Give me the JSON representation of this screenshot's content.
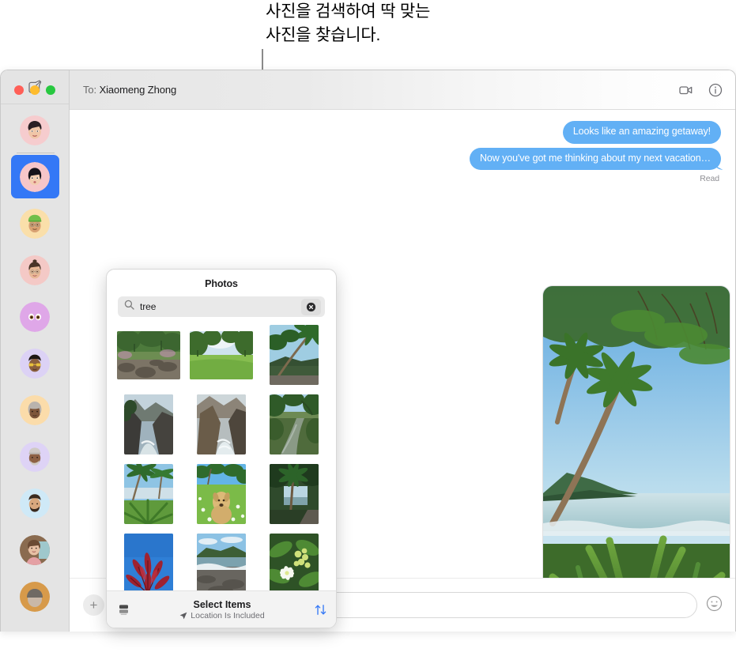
{
  "callout": {
    "text": "사진을 검색하여 딱 맞는\n사진을 찾습니다."
  },
  "window": {
    "traffic_lights": [
      "close",
      "minimize",
      "zoom"
    ],
    "toolbar": {
      "to_label": "To:",
      "recipient": "Xiaomeng Zhong",
      "video_icon": "video-camera-icon",
      "info_icon": "info-circle-icon"
    }
  },
  "sidebar": {
    "compose_icon": "compose-icon",
    "items": [
      {
        "name": "chat-1",
        "avatar": "memoji-woman-dark-hair",
        "bg": "#f6ccce",
        "selected": false
      },
      {
        "name": "chat-2",
        "avatar": "memoji-woman-black-bob",
        "bg": "#f7c6c9",
        "selected": true
      },
      {
        "name": "chat-3",
        "avatar": "memoji-green-beanie-glasses",
        "bg": "#fadfaa",
        "selected": false
      },
      {
        "name": "chat-4",
        "avatar": "memoji-woman-bun-glasses",
        "bg": "#f4c9c6",
        "selected": false
      },
      {
        "name": "chat-5",
        "avatar": "memoji-eyes-only",
        "bg": "#dfa7e8",
        "selected": false
      },
      {
        "name": "chat-6",
        "avatar": "memoji-yellow-sunglasses",
        "bg": "#dcd2f5",
        "selected": false
      },
      {
        "name": "chat-7",
        "avatar": "memoji-gray-hair-woman",
        "bg": "#fbdcaa",
        "selected": false
      },
      {
        "name": "chat-8",
        "avatar": "memoji-gray-beard-headwrap",
        "bg": "#ded3f6",
        "selected": false
      },
      {
        "name": "chat-9",
        "avatar": "memoji-beard-man",
        "bg": "#cfe9f7",
        "selected": false
      },
      {
        "name": "chat-10",
        "avatar": "photo-woman-portrait",
        "bg": "#8a6b4f",
        "selected": false
      },
      {
        "name": "chat-11",
        "avatar": "photo-person-partial",
        "bg": "#d79a4a",
        "selected": false
      }
    ]
  },
  "conversation": {
    "messages": [
      {
        "text": "Looks like an amazing getaway!",
        "side": "outgoing",
        "tail": false
      },
      {
        "text": "Now you've got me thinking about my next vacation…",
        "side": "outgoing",
        "tail": true
      }
    ],
    "status": "Read",
    "attachment": {
      "name": "tropical-beach-palms-photo",
      "alt": "Tropical coastline with palm trees and green foliage"
    },
    "bubble_color": "#62b0f5"
  },
  "composer": {
    "add_icon": "plus-icon",
    "input_placeholder": "",
    "input_value": "",
    "emoji_icon": "smiley-icon"
  },
  "photos_popover": {
    "title": "Photos",
    "search": {
      "icon": "search-icon",
      "value": "tree",
      "placeholder": "Search",
      "clear_icon": "clear-circle-icon"
    },
    "thumbnails": [
      {
        "name": "photo-forest-rocks",
        "alt": "Forest with rocky stream",
        "orient": "landscape"
      },
      {
        "name": "photo-green-meadow",
        "alt": "Green meadow with trees",
        "orient": "landscape"
      },
      {
        "name": "photo-palm-river",
        "alt": "Palm tree over river",
        "orient": "portrait"
      },
      {
        "name": "photo-coastal-cliffs-1",
        "alt": "Coastal cliffs and sea",
        "orient": "portrait"
      },
      {
        "name": "photo-coastal-cliffs-2",
        "alt": "Rocky coast with surf",
        "orient": "portrait"
      },
      {
        "name": "photo-jungle-river",
        "alt": "Jungle river reflection",
        "orient": "portrait"
      },
      {
        "name": "photo-palms-sky",
        "alt": "Palm trees against blue sky",
        "orient": "portrait"
      },
      {
        "name": "photo-dog-meadow",
        "alt": "Golden dog in flower meadow",
        "orient": "portrait"
      },
      {
        "name": "photo-palm-path",
        "alt": "Palm tree beside path",
        "orient": "portrait"
      },
      {
        "name": "photo-red-leaves",
        "alt": "Red leaves against blue sky",
        "orient": "portrait"
      },
      {
        "name": "photo-beach-shore",
        "alt": "Beach shoreline with hills",
        "orient": "portrait"
      },
      {
        "name": "photo-white-flower",
        "alt": "White flower with green buds",
        "orient": "portrait"
      }
    ],
    "footer": {
      "library_icon": "photo-library-icon",
      "title": "Select Items",
      "location_icon": "location-arrow-icon",
      "subtitle": "Location Is Included",
      "sort_icon": "sort-arrows-icon",
      "sort_color": "#3478f6"
    }
  }
}
